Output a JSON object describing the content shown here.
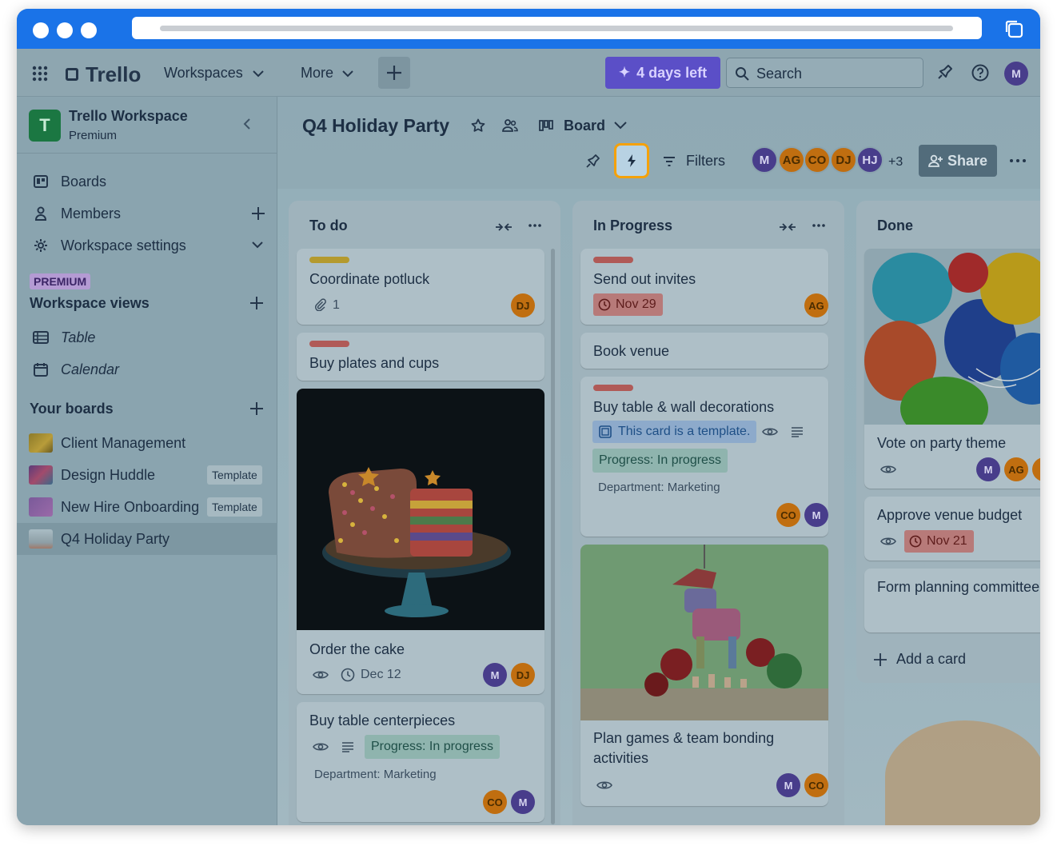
{
  "topnav": {
    "brand": "Trello",
    "workspaces": "Workspaces",
    "more": "More",
    "trial": "4 days left",
    "search_placeholder": "Search",
    "user_initial": "M"
  },
  "sidebar": {
    "workspace_name": "Trello Workspace",
    "workspace_plan": "Premium",
    "workspace_initial": "T",
    "nav": [
      {
        "label": "Boards"
      },
      {
        "label": "Members"
      },
      {
        "label": "Workspace settings"
      }
    ],
    "premium_tag": "PREMIUM",
    "views_title": "Workspace views",
    "views": [
      {
        "label": "Table"
      },
      {
        "label": "Calendar"
      }
    ],
    "boards_title": "Your boards",
    "boards": [
      {
        "label": "Client Management",
        "badge": ""
      },
      {
        "label": "Design Huddle",
        "badge": "Template"
      },
      {
        "label": "New Hire Onboarding",
        "badge": "Template"
      },
      {
        "label": "Q4 Holiday Party",
        "badge": ""
      }
    ]
  },
  "board": {
    "title": "Q4 Holiday Party",
    "view": "Board",
    "filters": "Filters",
    "members": [
      "M",
      "AG",
      "CO",
      "DJ",
      "HJ"
    ],
    "more_members": "+3",
    "share": "Share"
  },
  "lists": [
    {
      "title": "To do",
      "cards": [
        {
          "title": "Coordinate potluck",
          "label_color": "#b49a2e",
          "attachments": "1",
          "members": [
            "DJ"
          ]
        },
        {
          "title": "Buy plates and cups",
          "label_color": "#b05a57"
        },
        {
          "title": "Order the cake",
          "due": "Dec 12",
          "members": [
            "M",
            "DJ"
          ]
        },
        {
          "title": "Buy table centerpieces",
          "chip": "Progress: In progress",
          "field": "Department: Marketing",
          "members": [
            "CO",
            "M"
          ]
        }
      ]
    },
    {
      "title": "In Progress",
      "cards": [
        {
          "title": "Send out invites",
          "label_color": "#b05a57",
          "due": "Nov 29",
          "members": [
            "AG"
          ]
        },
        {
          "title": "Book venue"
        },
        {
          "title": "Buy table & wall decorations",
          "label_color": "#b05a57",
          "template_chip": "This card is a template.",
          "chip": "Progress: In progress",
          "field": "Department: Marketing",
          "members": [
            "CO",
            "M"
          ]
        },
        {
          "title": "Plan games & team bonding",
          "title_line2": "activities",
          "members": [
            "M",
            "CO"
          ]
        }
      ]
    },
    {
      "title": "Done",
      "cards": [
        {
          "title": "Vote on party theme",
          "members": [
            "M",
            "AG"
          ]
        },
        {
          "title": "Approve venue budget",
          "due": "Nov 21"
        },
        {
          "title": "Form planning committee"
        }
      ],
      "add_card": "Add a card"
    }
  ],
  "colors": {
    "browser_chrome": "#1a73e8",
    "trial_button": "#5b4fc7",
    "automation_highlight": "#f5a10a"
  }
}
